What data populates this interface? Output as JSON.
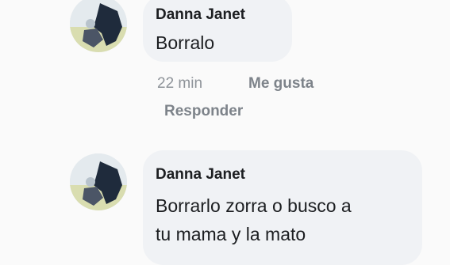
{
  "comments": [
    {
      "author": "Danna Janet",
      "text_lines": [
        "Borralo"
      ],
      "time": "22 min",
      "like_label": "Me gusta",
      "reply_label": "Responder"
    },
    {
      "author": "Danna Janet",
      "text_lines": [
        "Borrarlo zorra o busco a",
        "tu mama y la mato"
      ]
    }
  ],
  "icons": {
    "avatar": "profile-photo"
  }
}
